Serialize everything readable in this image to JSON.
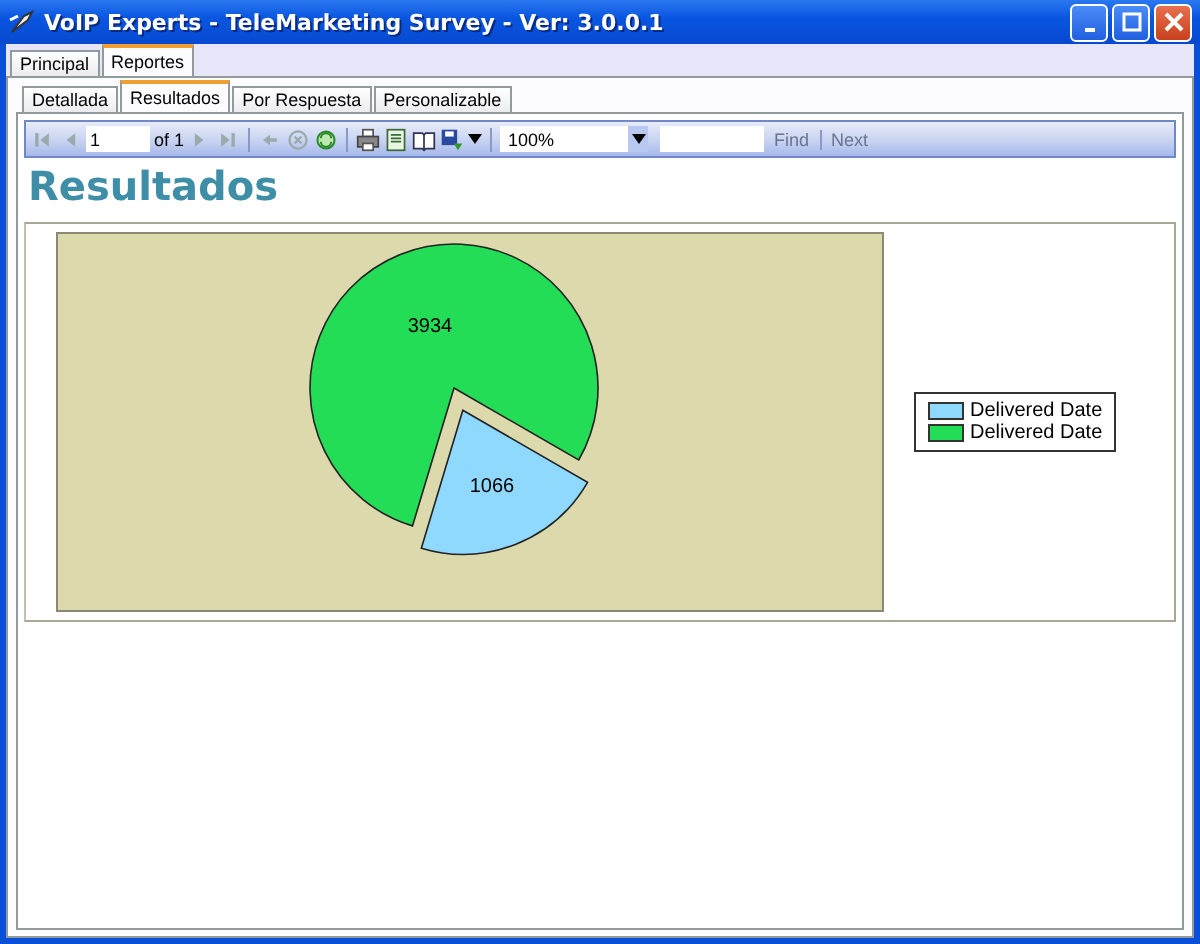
{
  "window": {
    "title": "VoIP Experts - TeleMarketing Survey - Ver: 3.0.0.1"
  },
  "tabs": [
    {
      "label": "Principal",
      "selected": false
    },
    {
      "label": "Reportes",
      "selected": true
    }
  ],
  "subtabs": [
    {
      "label": "Detallada",
      "selected": false
    },
    {
      "label": "Resultados",
      "selected": true
    },
    {
      "label": "Por Respuesta",
      "selected": false
    },
    {
      "label": "Personalizable",
      "selected": false
    }
  ],
  "toolbar": {
    "page": "1",
    "page_count": "of 1",
    "zoom": "100%",
    "find": {
      "label": "Find",
      "disabled": true
    },
    "next": {
      "label": "Next",
      "disabled": true
    }
  },
  "report": {
    "title": "Resultados",
    "chart_data": {
      "type": "pie",
      "categories": [
        "Delivered Date",
        "Delivered Date"
      ],
      "colors": [
        "#8fd8ff",
        "#22dd55"
      ],
      "series": [
        {
          "values": [
            1066,
            3934
          ]
        }
      ],
      "data_labels": true
    }
  }
}
